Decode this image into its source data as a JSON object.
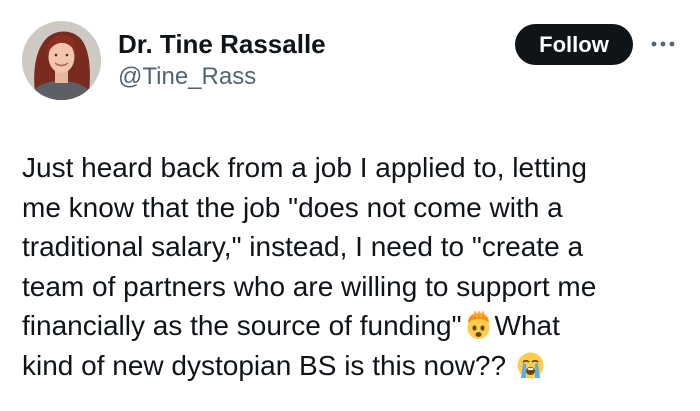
{
  "author": {
    "display_name": "Dr. Tine Rassalle",
    "handle": "@Tine_Rass"
  },
  "actions": {
    "follow_label": "Follow",
    "more_icon": "more-horizontal-icon"
  },
  "tweet": {
    "lines": [
      "Just heard back from a job I applied to, letting",
      "me know that the job \"does not come with a",
      "traditional salary,\" instead, I need to \"create a",
      "team of partners who are willing to support me",
      "financially as the source of funding\"",
      "What",
      "kind of new dystopian BS is this now??"
    ],
    "emojis": [
      "exploding-head-emoji",
      "loudly-crying-face-emoji"
    ]
  },
  "colors": {
    "text": "#0f1419",
    "secondary_text": "#536471",
    "follow_button_bg": "#0f1419",
    "follow_button_text": "#ffffff"
  }
}
